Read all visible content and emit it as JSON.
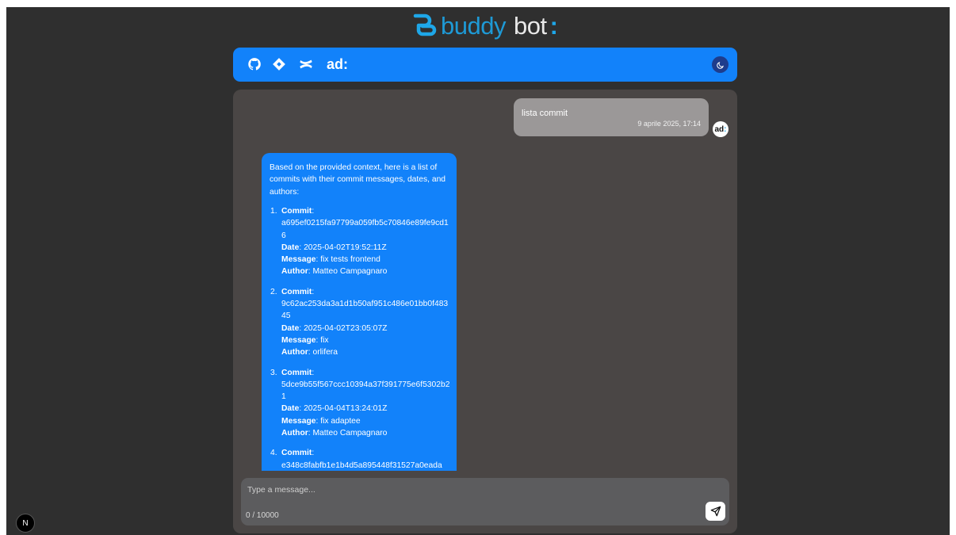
{
  "brand": {
    "word1": "buddy",
    "word2": "bot",
    "colon": ":"
  },
  "topbar": {
    "label": "ad:"
  },
  "user_message": {
    "text": "lista commit",
    "time": "9 aprile 2025, 17:14"
  },
  "avatar": {
    "a": "ad",
    "c": ":"
  },
  "bot_message": {
    "intro": "Based on the provided context, here is a list of commits with their commit messages, dates, and authors:",
    "commit_label": "Commit",
    "date_label": "Date",
    "message_label": "Message",
    "author_label": "Author",
    "commits": [
      {
        "num": "1.",
        "hash": "a695ef0215fa97799a059fb5c70846e89fe9cd16",
        "date": "2025-04-02T19:52:11Z",
        "message": "fix tests frontend",
        "author": "Matteo Campagnaro"
      },
      {
        "num": "2.",
        "hash": "9c62ac253da3a1d1b50af951c486e01bb0f48345",
        "date": "2025-04-02T23:05:07Z",
        "message": "fix",
        "author": "orlifera"
      },
      {
        "num": "3.",
        "hash": "5dce9b55f567ccc10394a37f391775e6f5302b21",
        "date": "2025-04-04T13:24:01Z",
        "message": "fix adaptee",
        "author": "Matteo Campagnaro"
      },
      {
        "num": "4.",
        "hash": "e348c8fabfb1e1b4d5a895448f31527a0eada",
        "date": "",
        "message": "",
        "author": ""
      }
    ]
  },
  "composer": {
    "placeholder": "Type a message...",
    "counter": "0 / 10000"
  },
  "next_badge": {
    "letter": "N"
  },
  "colors": {
    "accent": "#1282fa",
    "background": "#2f2f2f",
    "panel": "#4a4645",
    "user_bubble": "#9b9898"
  }
}
